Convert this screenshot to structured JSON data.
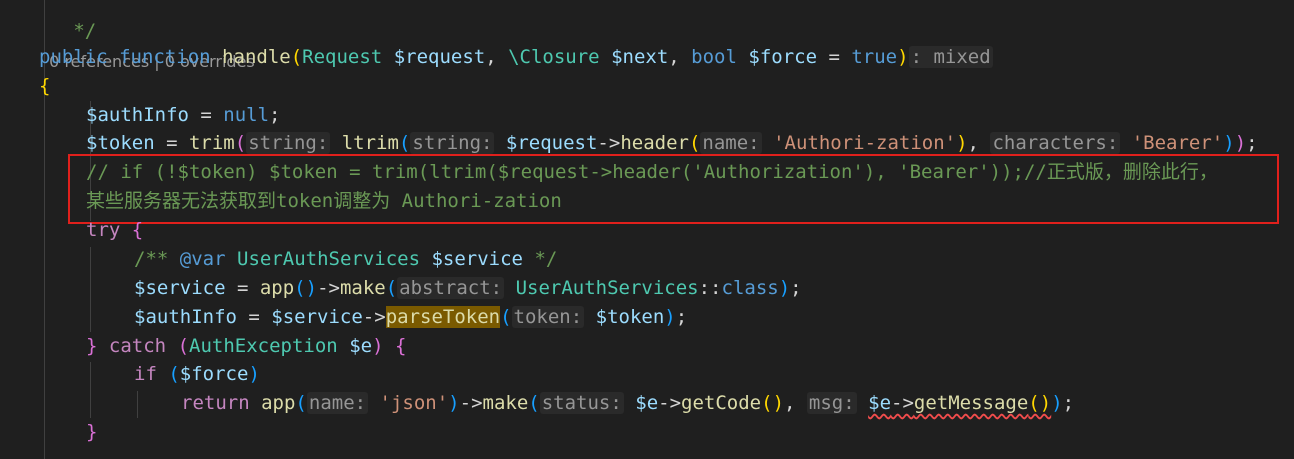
{
  "codelens": {
    "text": "0 references | 0 overrides"
  },
  "signature": {
    "kw_public": "public",
    "kw_function": "function",
    "name": "handle",
    "p1_type": "Request",
    "p1_var": "$request",
    "p2_type": "\\Closure",
    "p2_var": "$next",
    "p3_type": "bool",
    "p3_var": "$force",
    "p3_default": "true",
    "return_type": "mixed"
  },
  "body": {
    "authinfo_var": "$authInfo",
    "null_kw": "null",
    "token_var": "$token",
    "trim_fn": "trim",
    "hint_string": "string:",
    "ltrim_fn": "ltrim",
    "request_var": "$request",
    "header_fn": "header",
    "hint_name": "name:",
    "authori_str": "'Authori-zation'",
    "hint_characters": "characters:",
    "bearer_str": "'Bearer'"
  },
  "comment": {
    "line1": "// if (!$token) $token = trim(ltrim($request->header('Authorization'), 'Bearer'));//正式版，删除此行，",
    "line2": "某些服务器无法获取到token调整为 Authori-zation"
  },
  "try_block": {
    "kw_try": "try",
    "doc_open": "/**",
    "doc_tag": "@var",
    "doc_type": "UserAuthServices",
    "doc_var": "$service",
    "doc_close": "*/",
    "service_var": "$service",
    "app_fn": "app",
    "make_fn": "make",
    "hint_abstract": "abstract:",
    "class_type": "UserAuthServices",
    "class_kw": "class",
    "parse_fn": "parseToken",
    "hint_token": "token:"
  },
  "catch_block": {
    "kw_catch": "catch",
    "ex_type": "AuthException",
    "ex_var": "$e",
    "kw_if": "if",
    "force_var": "$force",
    "kw_return": "return",
    "json_str": "'json'",
    "hint_status": "status:",
    "getcode_fn": "getCode",
    "hint_msg": "msg:",
    "getmessage_fn": "getMessage"
  }
}
